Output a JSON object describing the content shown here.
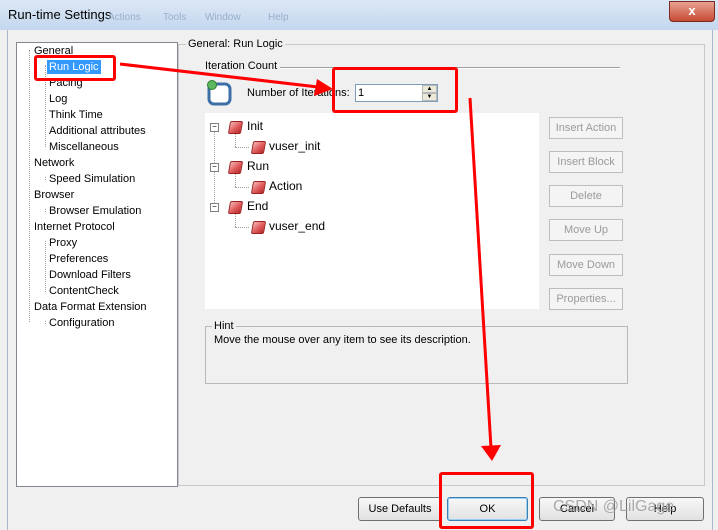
{
  "window": {
    "title": "Run-time Settings",
    "ghost_menu": [
      "Actions",
      "Tools",
      "Window",
      "Help"
    ],
    "close_label": "x"
  },
  "tree": {
    "items": [
      {
        "label": "General",
        "level": 0
      },
      {
        "label": "Run Logic",
        "level": 1,
        "selected": true
      },
      {
        "label": "Pacing",
        "level": 1
      },
      {
        "label": "Log",
        "level": 1
      },
      {
        "label": "Think Time",
        "level": 1
      },
      {
        "label": "Additional attributes",
        "level": 1
      },
      {
        "label": "Miscellaneous",
        "level": 1
      },
      {
        "label": "Network",
        "level": 0
      },
      {
        "label": "Speed Simulation",
        "level": 1
      },
      {
        "label": "Browser",
        "level": 0
      },
      {
        "label": "Browser Emulation",
        "level": 1
      },
      {
        "label": "Internet Protocol",
        "level": 0
      },
      {
        "label": "Proxy",
        "level": 1
      },
      {
        "label": "Preferences",
        "level": 1
      },
      {
        "label": "Download Filters",
        "level": 1
      },
      {
        "label": "ContentCheck",
        "level": 1
      },
      {
        "label": "Data Format Extension",
        "level": 0
      },
      {
        "label": "Configuration",
        "level": 1
      }
    ]
  },
  "main": {
    "section_title": "General: Run Logic",
    "iteration": {
      "group_label": "Iteration Count",
      "number_label": "Number of Iterations:",
      "value": "1"
    },
    "action_tree": [
      {
        "label": "Init",
        "children": [
          "vuser_init"
        ]
      },
      {
        "label": "Run",
        "children": [
          "Action"
        ]
      },
      {
        "label": "End",
        "children": [
          "vuser_end"
        ]
      }
    ],
    "side_buttons": [
      "Insert Action",
      "Insert Block",
      "Delete",
      "Move Up",
      "Move Down",
      "Properties..."
    ],
    "hint": {
      "label": "Hint",
      "text": "Move the mouse over any item to see its description."
    }
  },
  "buttons": {
    "use_defaults": "Use Defaults",
    "ok": "OK",
    "cancel": "Cancel",
    "help": "Help"
  },
  "watermark": "CSDN @LilGage",
  "colors": {
    "selection": "#3399ff",
    "annotation": "#ff0000"
  }
}
